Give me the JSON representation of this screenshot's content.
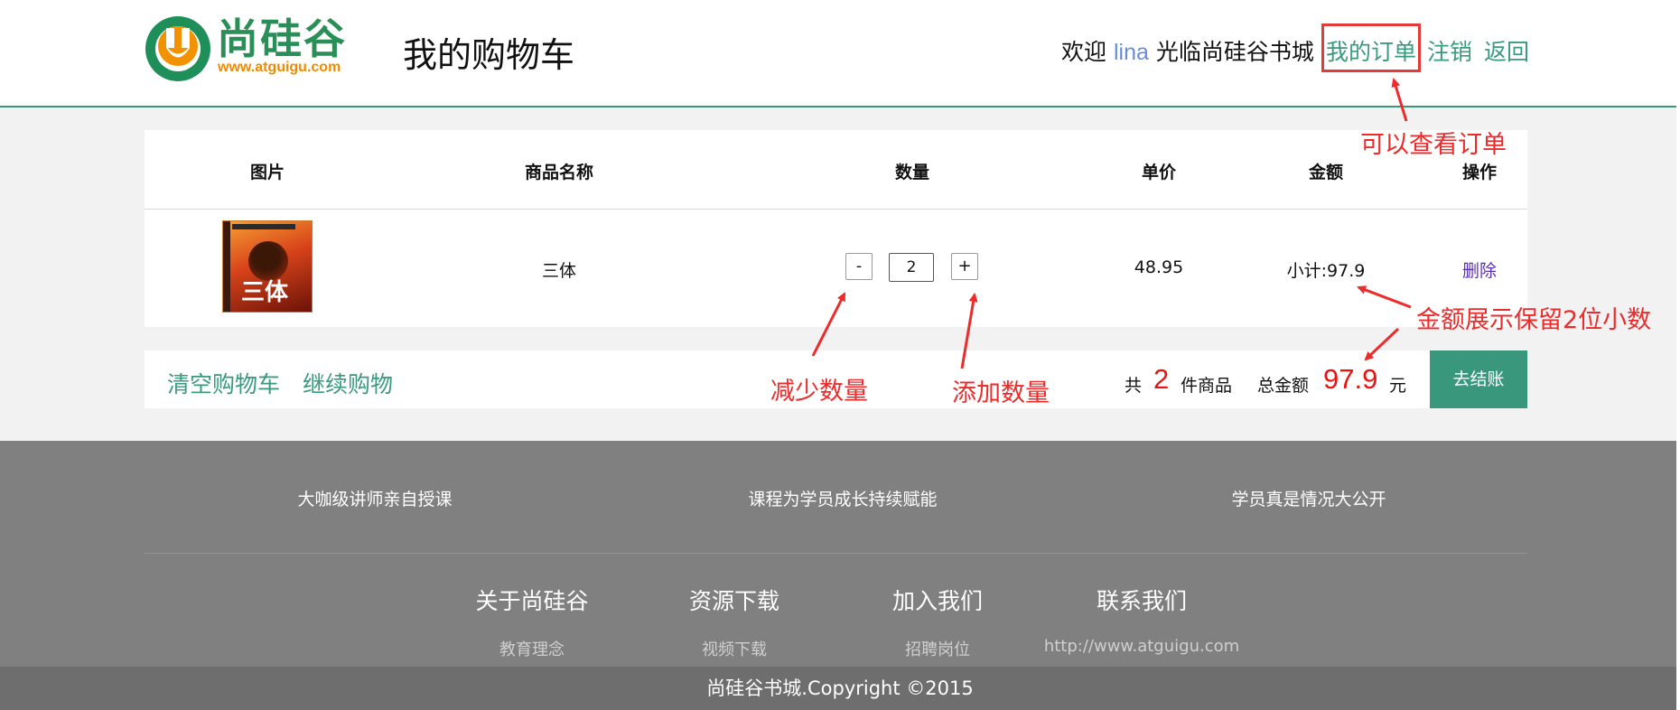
{
  "header": {
    "logo_text": "尚硅谷",
    "logo_url": "www.atguigu.com",
    "page_title": "我的购物车",
    "welcome_prefix": "欢迎",
    "username": "lina",
    "welcome_suffix": "光临尚硅谷书城",
    "my_orders": "我的订单",
    "logout": "注销",
    "back": "返回"
  },
  "cart": {
    "columns": [
      "图片",
      "商品名称",
      "数量",
      "单价",
      "金额",
      "操作"
    ],
    "items": [
      {
        "cover_title": "三体",
        "name": "三体",
        "decrease": "-",
        "quantity": "2",
        "increase": "+",
        "price": "48.95",
        "subtotal": "小计:97.9",
        "action": "删除"
      }
    ]
  },
  "summary": {
    "clear_cart": "清空购物车",
    "continue_shopping": "继续购物",
    "count_prefix": "共",
    "count": "2",
    "count_suffix": "件商品",
    "total_label": "总金额",
    "total": "97.9",
    "currency": "元",
    "checkout": "去结账"
  },
  "annotations": {
    "view_orders": "可以查看订单",
    "amount_format": "金额展示保留2位小数",
    "decrease_qty": "减少数量",
    "increase_qty": "添加数量"
  },
  "footer": {
    "taglines": [
      "大咖级讲师亲自授课",
      "课程为学员成长持续赋能",
      "学员真是情况大公开"
    ],
    "nav": [
      {
        "title": "关于尚硅谷",
        "sub": "教育理念"
      },
      {
        "title": "资源下载",
        "sub": "视频下载"
      },
      {
        "title": "加入我们",
        "sub": "招聘岗位"
      },
      {
        "title": "联系我们",
        "sub": "http://www.atguigu.com"
      }
    ],
    "copyright": "尚硅谷书城.Copyright ©2015"
  },
  "colors": {
    "accent": "#39987c",
    "link": "#3a9a7e",
    "annotation": "#ee2b2b",
    "price_red": "#ee1111",
    "footer_bg": "#808080"
  }
}
